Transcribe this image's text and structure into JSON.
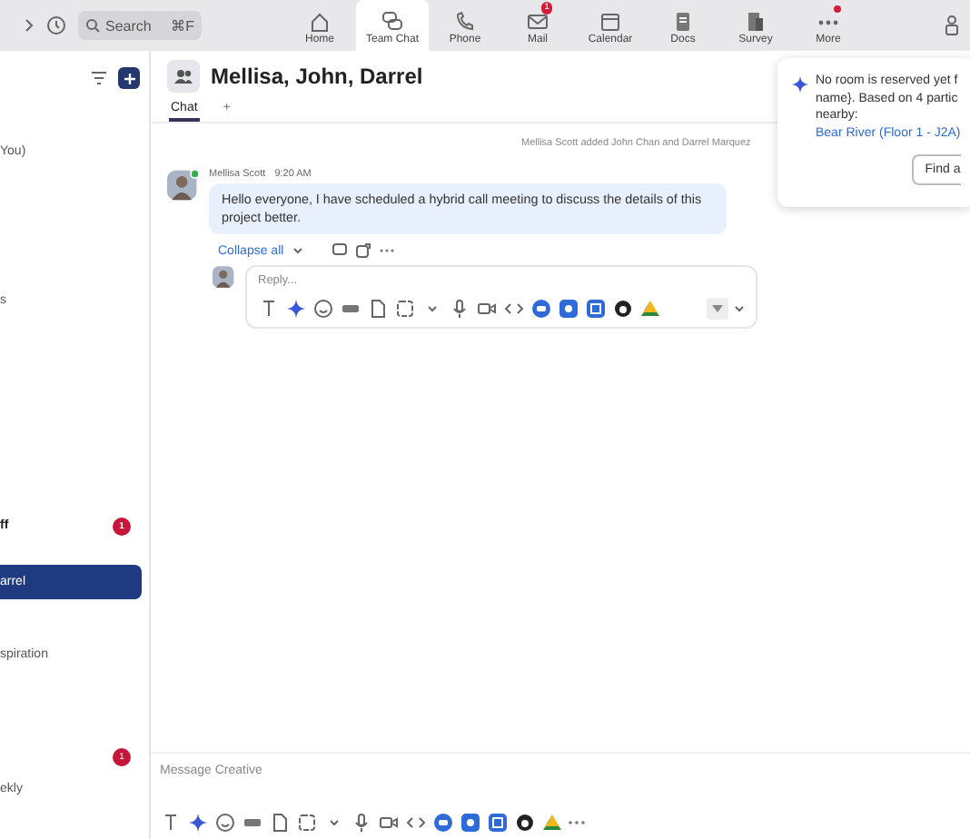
{
  "toolbar": {
    "search": {
      "placeholder": "Search",
      "shortcut": "⌘F"
    }
  },
  "nav_tabs": [
    {
      "label": "Home",
      "selected": false,
      "dot": false
    },
    {
      "label": "Team Chat",
      "selected": true,
      "dot": false
    },
    {
      "label": "Phone",
      "selected": false,
      "dot": false
    },
    {
      "label": "Mail",
      "selected": false,
      "dot": false,
      "badge": "1"
    },
    {
      "label": "Calendar",
      "selected": false,
      "dot": false
    },
    {
      "label": "Docs",
      "selected": false,
      "dot": false
    },
    {
      "label": "Survey",
      "selected": false,
      "dot": false
    },
    {
      "label": "More",
      "selected": false,
      "dot": true
    }
  ],
  "sidebar": {
    "items": [
      {
        "label": "You)",
        "selected": false,
        "unread": false
      },
      {
        "label": "s",
        "selected": false,
        "unread": false
      },
      {
        "label": "ff",
        "selected": false,
        "unread": true,
        "badge": "1"
      },
      {
        "label": "arrel",
        "selected": true,
        "unread": false
      },
      {
        "label": "spiration",
        "selected": false,
        "unread": false
      },
      {
        "preview": "ekly",
        "selected": false,
        "unread": false,
        "badge": "1"
      }
    ]
  },
  "chat": {
    "title": "Mellisa, John, Darrel",
    "tabs": [
      {
        "label": "Chat",
        "selected": true
      },
      {
        "label": "+",
        "selected": false
      }
    ],
    "system_message": "Mellisa Scott added John Chan and Darrel Marquez",
    "messages": [
      {
        "sender": "Mellisa Scott",
        "time": "9:20 AM",
        "online": true,
        "text": "Hello everyone, I have scheduled a hybrid call meeting to discuss the details of this project better.",
        "collapse_link": "Collapse all",
        "reply_placeholder": "Reply..."
      }
    ],
    "composer": {
      "placeholder": "Message Creative"
    }
  },
  "room_popup": {
    "text_lines": [
      "No room is reserved yet f",
      "name}. Based on 4 partic",
      "nearby:"
    ],
    "link": "Bear River (Floor 1 - J2A)",
    "button": "Find a"
  }
}
